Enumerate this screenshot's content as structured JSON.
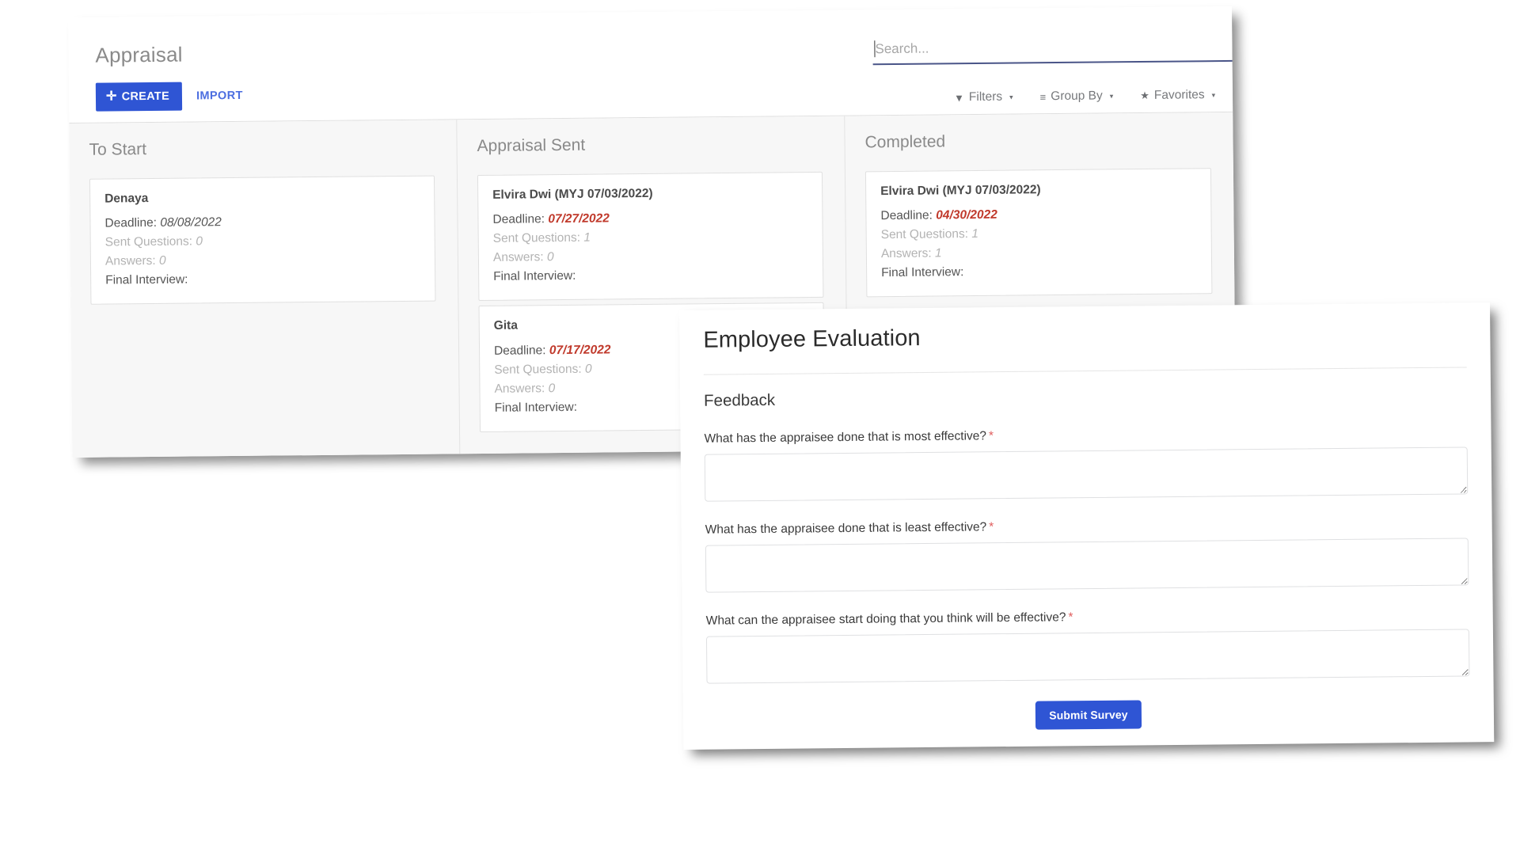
{
  "kanban": {
    "title": "Appraisal",
    "create_label": "CREATE",
    "create_icon": "plus-icon",
    "import_label": "IMPORT",
    "search": {
      "placeholder": "Search...",
      "value": ""
    },
    "controls": [
      {
        "label": "Filters",
        "icon": "funnel-icon",
        "glyph": "▼",
        "caret": "▾"
      },
      {
        "label": "Group By",
        "icon": "hamburger-icon",
        "glyph": "≡",
        "caret": "▾"
      },
      {
        "label": "Favorites",
        "icon": "star-icon",
        "glyph": "★",
        "caret": "▾"
      }
    ],
    "columns": [
      {
        "title": "To Start",
        "cards": [
          {
            "name": "Denaya",
            "deadline_label": "Deadline:",
            "deadline_value": "08/08/2022",
            "deadline_overdue": false,
            "sent_questions_label": "Sent Questions:",
            "sent_questions_value": "0",
            "answers_label": "Answers:",
            "answers_value": "0",
            "final_interview_label": "Final Interview:",
            "final_interview_value": ""
          }
        ]
      },
      {
        "title": "Appraisal Sent",
        "cards": [
          {
            "name": "Elvira Dwi (MYJ 07/03/2022)",
            "deadline_label": "Deadline:",
            "deadline_value": "07/27/2022",
            "deadline_overdue": true,
            "sent_questions_label": "Sent Questions:",
            "sent_questions_value": "1",
            "answers_label": "Answers:",
            "answers_value": "0",
            "final_interview_label": "Final Interview:",
            "final_interview_value": ""
          },
          {
            "name": "Gita",
            "deadline_label": "Deadline:",
            "deadline_value": "07/17/2022",
            "deadline_overdue": true,
            "sent_questions_label": "Sent Questions:",
            "sent_questions_value": "0",
            "answers_label": "Answers:",
            "answers_value": "0",
            "final_interview_label": "Final Interview:",
            "final_interview_value": ""
          }
        ]
      },
      {
        "title": "Completed",
        "cards": [
          {
            "name": "Elvira Dwi (MYJ 07/03/2022)",
            "deadline_label": "Deadline:",
            "deadline_value": "04/30/2022",
            "deadline_overdue": true,
            "sent_questions_label": "Sent Questions:",
            "sent_questions_value": "1",
            "answers_label": "Answers:",
            "answers_value": "1",
            "final_interview_label": "Final Interview:",
            "final_interview_value": ""
          }
        ]
      }
    ]
  },
  "evaluation": {
    "title": "Employee Evaluation",
    "section_title": "Feedback",
    "required_marker": "*",
    "questions": [
      {
        "label": "What has the appraisee done that is most effective?",
        "required": true,
        "value": ""
      },
      {
        "label": "What has the appraisee done that is least effective?",
        "required": true,
        "value": ""
      },
      {
        "label": "What can the appraisee start doing that you think will be effective?",
        "required": true,
        "value": ""
      }
    ],
    "submit_label": "Submit Survey"
  },
  "colors": {
    "accent": "#2f55d4",
    "link": "#4c6ee0",
    "overdue": "#c0392b",
    "required": "#e05b5b",
    "muted": "#b3b3b3",
    "board_bg": "#f7f7f7"
  }
}
